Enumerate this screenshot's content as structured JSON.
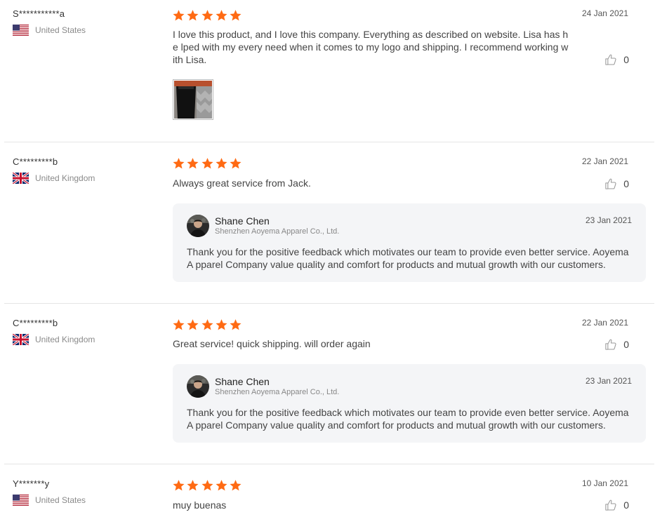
{
  "colors": {
    "star": "#ff6a13",
    "text": "#444444",
    "muted": "#8a8a8a",
    "reply_bg": "#f4f5f7"
  },
  "reviews": [
    {
      "name": "S***********a",
      "country": "United States",
      "flag": "us-flag-icon",
      "rating": 5,
      "date": "24 Jan 2021",
      "text": "I love this product, and I love this company. Everything as described on website.  Lisa has he lped with my every need when it comes to my logo and shipping. I recommend working with Lisa.",
      "helpful_count": "0",
      "has_image": true
    },
    {
      "name": "C*********b",
      "country": "United Kingdom",
      "flag": "uk-flag-icon",
      "rating": 5,
      "date": "22 Jan 2021",
      "text": "Always great service from Jack.",
      "helpful_count": "0",
      "reply": {
        "name": "Shane Chen",
        "company": "Shenzhen Aoyema Apparel Co., Ltd.",
        "date": "23 Jan 2021",
        "text": "Thank you for the positive feedback which motivates our team to provide even better service. Aoyema A pparel Company value quality and comfort for products and mutual growth with our customers."
      }
    },
    {
      "name": "C*********b",
      "country": "United Kingdom",
      "flag": "uk-flag-icon",
      "rating": 5,
      "date": "22 Jan 2021",
      "text": "Great service! quick shipping. will order again",
      "helpful_count": "0",
      "reply": {
        "name": "Shane Chen",
        "company": "Shenzhen Aoyema Apparel Co., Ltd.",
        "date": "23 Jan 2021",
        "text": "Thank you for the positive feedback which motivates our team to provide even better service. Aoyema A pparel Company value quality and comfort for products and mutual growth with our customers."
      }
    },
    {
      "name": "Y*******y",
      "country": "United States",
      "flag": "us-flag-icon",
      "rating": 5,
      "date": "10 Jan 2021",
      "text": "muy buenas",
      "helpful_count": "0"
    }
  ]
}
